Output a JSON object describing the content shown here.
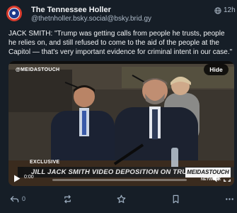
{
  "post": {
    "author": {
      "display_name": "The Tennessee Holler",
      "handle": "@thetnholler.bsky.social@bsky.brid.gy"
    },
    "visibility_icon": "globe-icon",
    "timestamp": "12h",
    "text": "JACK SMITH: \"Trump was getting calls from people he trusts, people he relies on, and still refused to come to the aid of the people at the Capitol — that's very important evidence for criminal intent in our case.\""
  },
  "video": {
    "watermark": "@MEIDASTOUCH",
    "hide_label": "Hide",
    "chyron_tag": "EXCLUSIVE",
    "chyron_headline": "JILL JACK SMITH VIDEO DEPOSITION ON TRUMP CRIMES",
    "chyron_brand": "MEIDASTOUCH",
    "chyron_brand_sub": "NETWORK",
    "player": {
      "current_time": "0:00",
      "total_time": "",
      "progress_fraction": 0,
      "play_icon": "play-icon",
      "volume_icon": "volume-icon",
      "fullscreen_icon": "fullscreen-icon"
    }
  },
  "actions": {
    "reply": {
      "icon": "reply-icon",
      "count": "0"
    },
    "boost": {
      "icon": "boost-icon"
    },
    "favourite": {
      "icon": "star-icon"
    },
    "bookmark": {
      "icon": "bookmark-icon"
    },
    "more": {
      "icon": "more-icon"
    }
  },
  "colors": {
    "background": "#161e27",
    "text_primary": "#f1f3f5",
    "text_secondary": "#aebbc9",
    "action_icons": "#9fb0c2"
  }
}
